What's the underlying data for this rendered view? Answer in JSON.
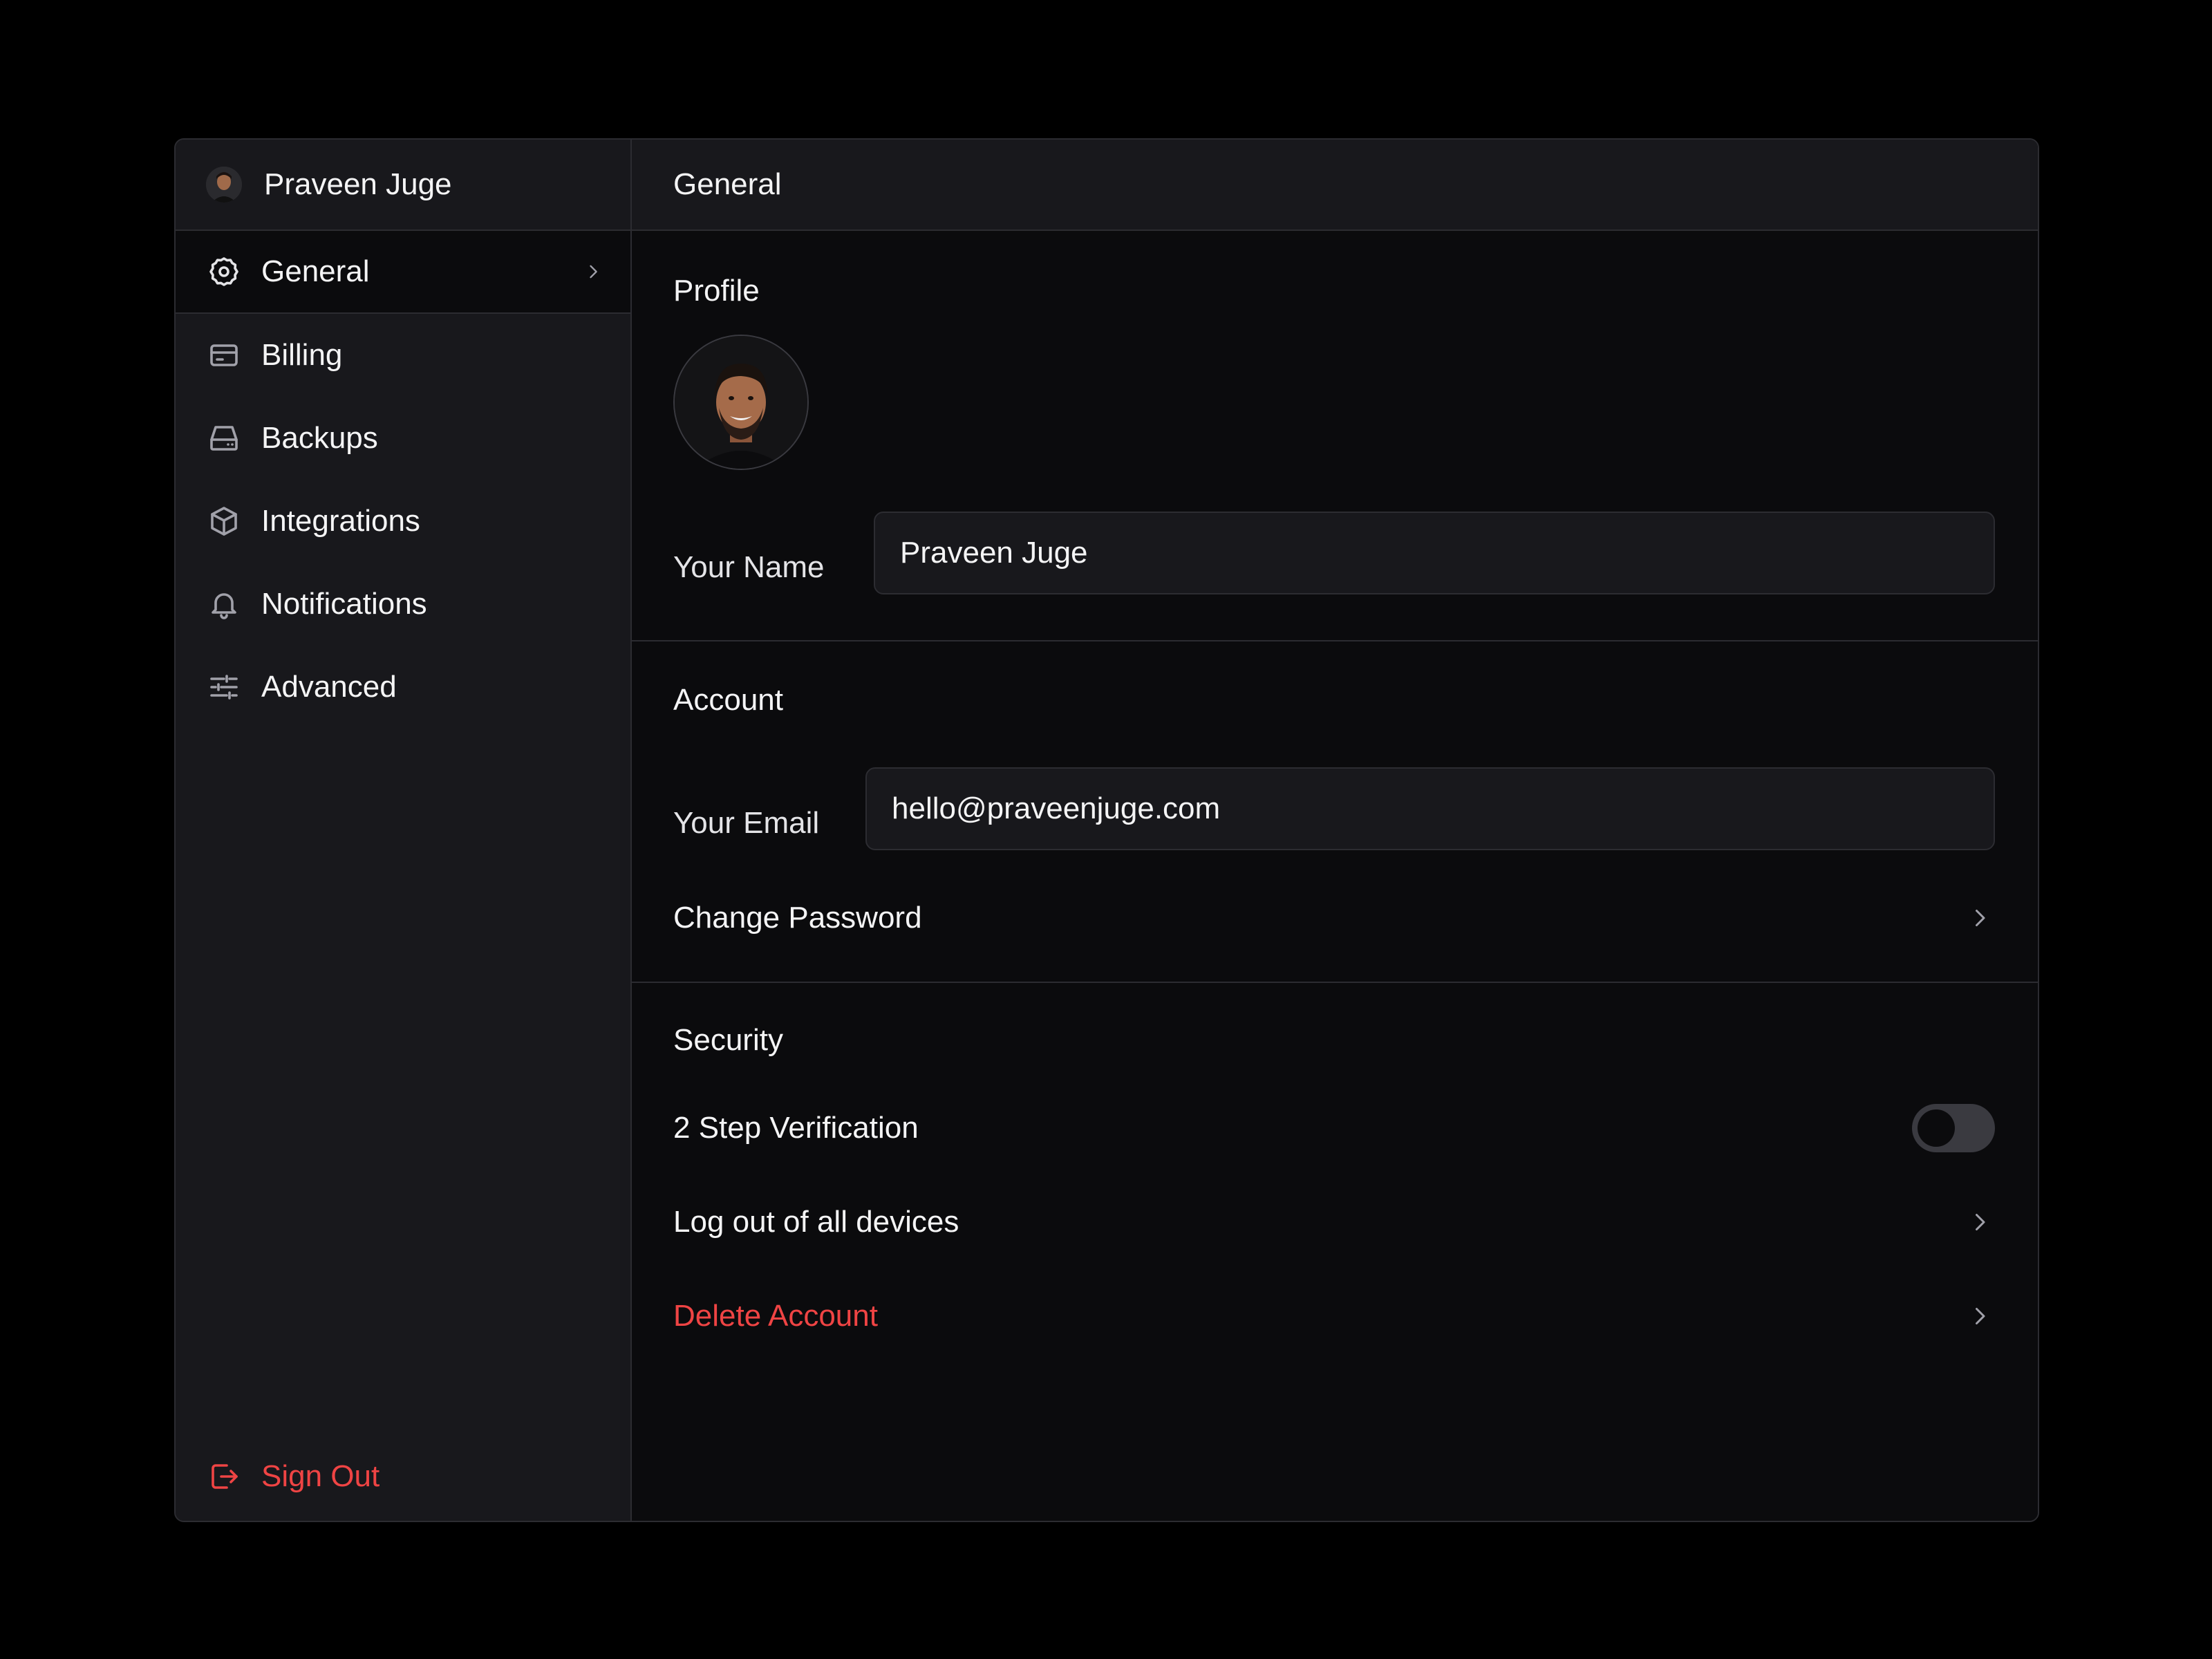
{
  "sidebar": {
    "user_name": "Praveen Juge",
    "items": [
      {
        "label": "General",
        "icon": "gear-icon",
        "active": true
      },
      {
        "label": "Billing",
        "icon": "credit-card-icon"
      },
      {
        "label": "Backups",
        "icon": "hard-drive-icon"
      },
      {
        "label": "Integrations",
        "icon": "cube-icon"
      },
      {
        "label": "Notifications",
        "icon": "bell-icon"
      },
      {
        "label": "Advanced",
        "icon": "sliders-icon"
      }
    ],
    "sign_out": {
      "label": "Sign Out",
      "icon": "sign-out-icon"
    }
  },
  "header": {
    "title": "General"
  },
  "profile": {
    "title": "Profile",
    "name_label": "Your Name",
    "name_value": "Praveen Juge"
  },
  "account": {
    "title": "Account",
    "email_label": "Your Email",
    "email_value": "hello@praveenjuge.com",
    "change_password": "Change Password"
  },
  "security": {
    "title": "Security",
    "two_step": "2 Step Verification",
    "two_step_enabled": false,
    "logout_all": "Log out of all devices",
    "delete_account": "Delete Account"
  },
  "colors": {
    "background": "#000000",
    "panel": "#18181c",
    "content": "#0b0b0d",
    "border": "#2c2c31",
    "danger": "#ef4444",
    "text": "#f4f4f5"
  }
}
